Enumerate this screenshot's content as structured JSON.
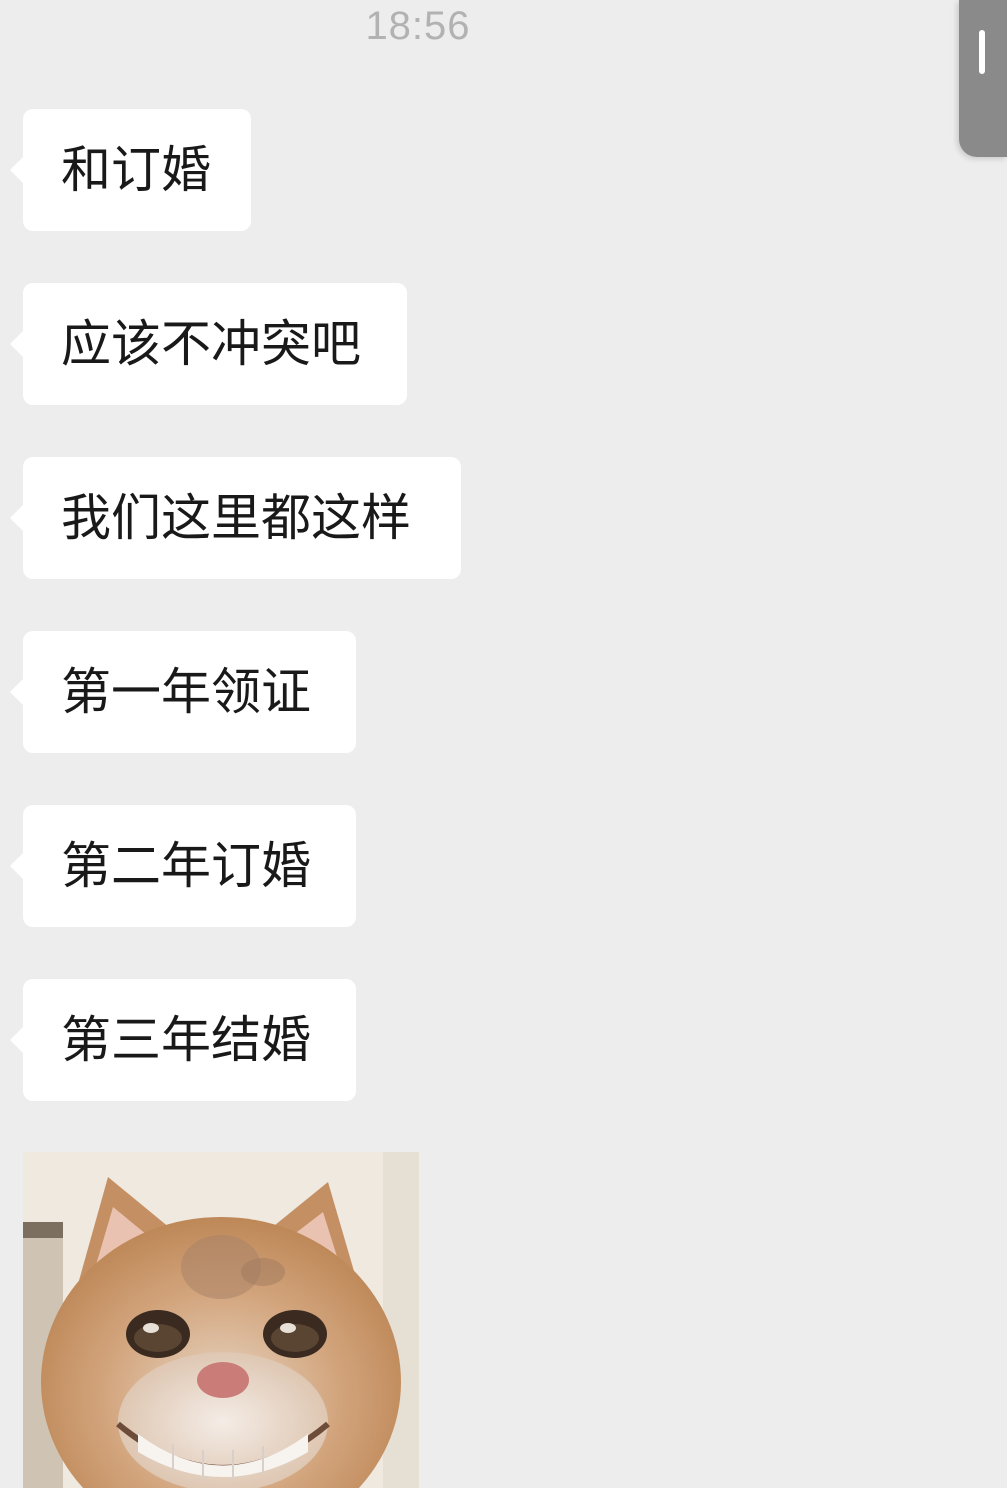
{
  "chat": {
    "timestamp": "18:56",
    "messages": [
      {
        "text": "和订婚"
      },
      {
        "text": "应该不冲突吧"
      },
      {
        "text": "我们这里都这样"
      },
      {
        "text": "第一年领证"
      },
      {
        "text": "第二年订婚"
      },
      {
        "text": "第三年结婚"
      }
    ]
  },
  "colors": {
    "background": "#ededed",
    "bubble": "#ffffff",
    "text": "#191919",
    "timestamp": "#b2b2b2"
  }
}
